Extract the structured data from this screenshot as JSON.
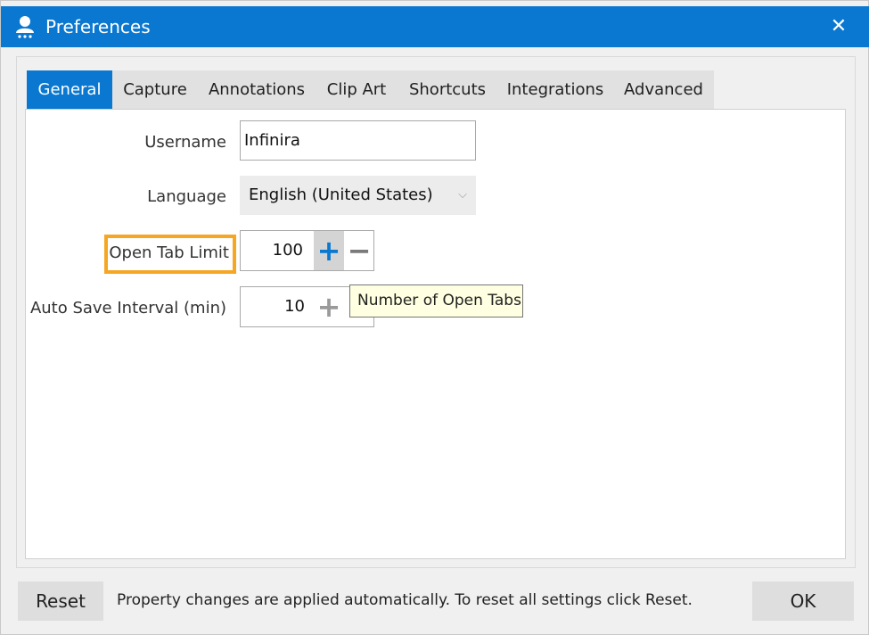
{
  "window": {
    "title": "Preferences",
    "app_icon": "user-icon",
    "close_icon": "close-icon"
  },
  "tabs": [
    {
      "label": "General",
      "active": true
    },
    {
      "label": "Capture",
      "active": false
    },
    {
      "label": "Annotations",
      "active": false
    },
    {
      "label": "Clip Art",
      "active": false
    },
    {
      "label": "Shortcuts",
      "active": false
    },
    {
      "label": "Integrations",
      "active": false
    },
    {
      "label": "Advanced",
      "active": false
    }
  ],
  "general": {
    "username": {
      "label": "Username",
      "value": "Infinira"
    },
    "language": {
      "label": "Language",
      "value": "English (United States)"
    },
    "open_tab_limit": {
      "label": "Open Tab Limit",
      "value": "100",
      "tooltip": "Number of Open Tabs"
    },
    "auto_save_interval": {
      "label": "Auto Save Interval (min)",
      "value": "10"
    }
  },
  "footer": {
    "reset_label": "Reset",
    "message": "Property changes are applied automatically. To reset all settings click Reset.",
    "ok_label": "OK"
  },
  "colors": {
    "accent": "#0a78d0",
    "highlight": "#f5a623",
    "tooltip_bg": "#ffffe1"
  }
}
